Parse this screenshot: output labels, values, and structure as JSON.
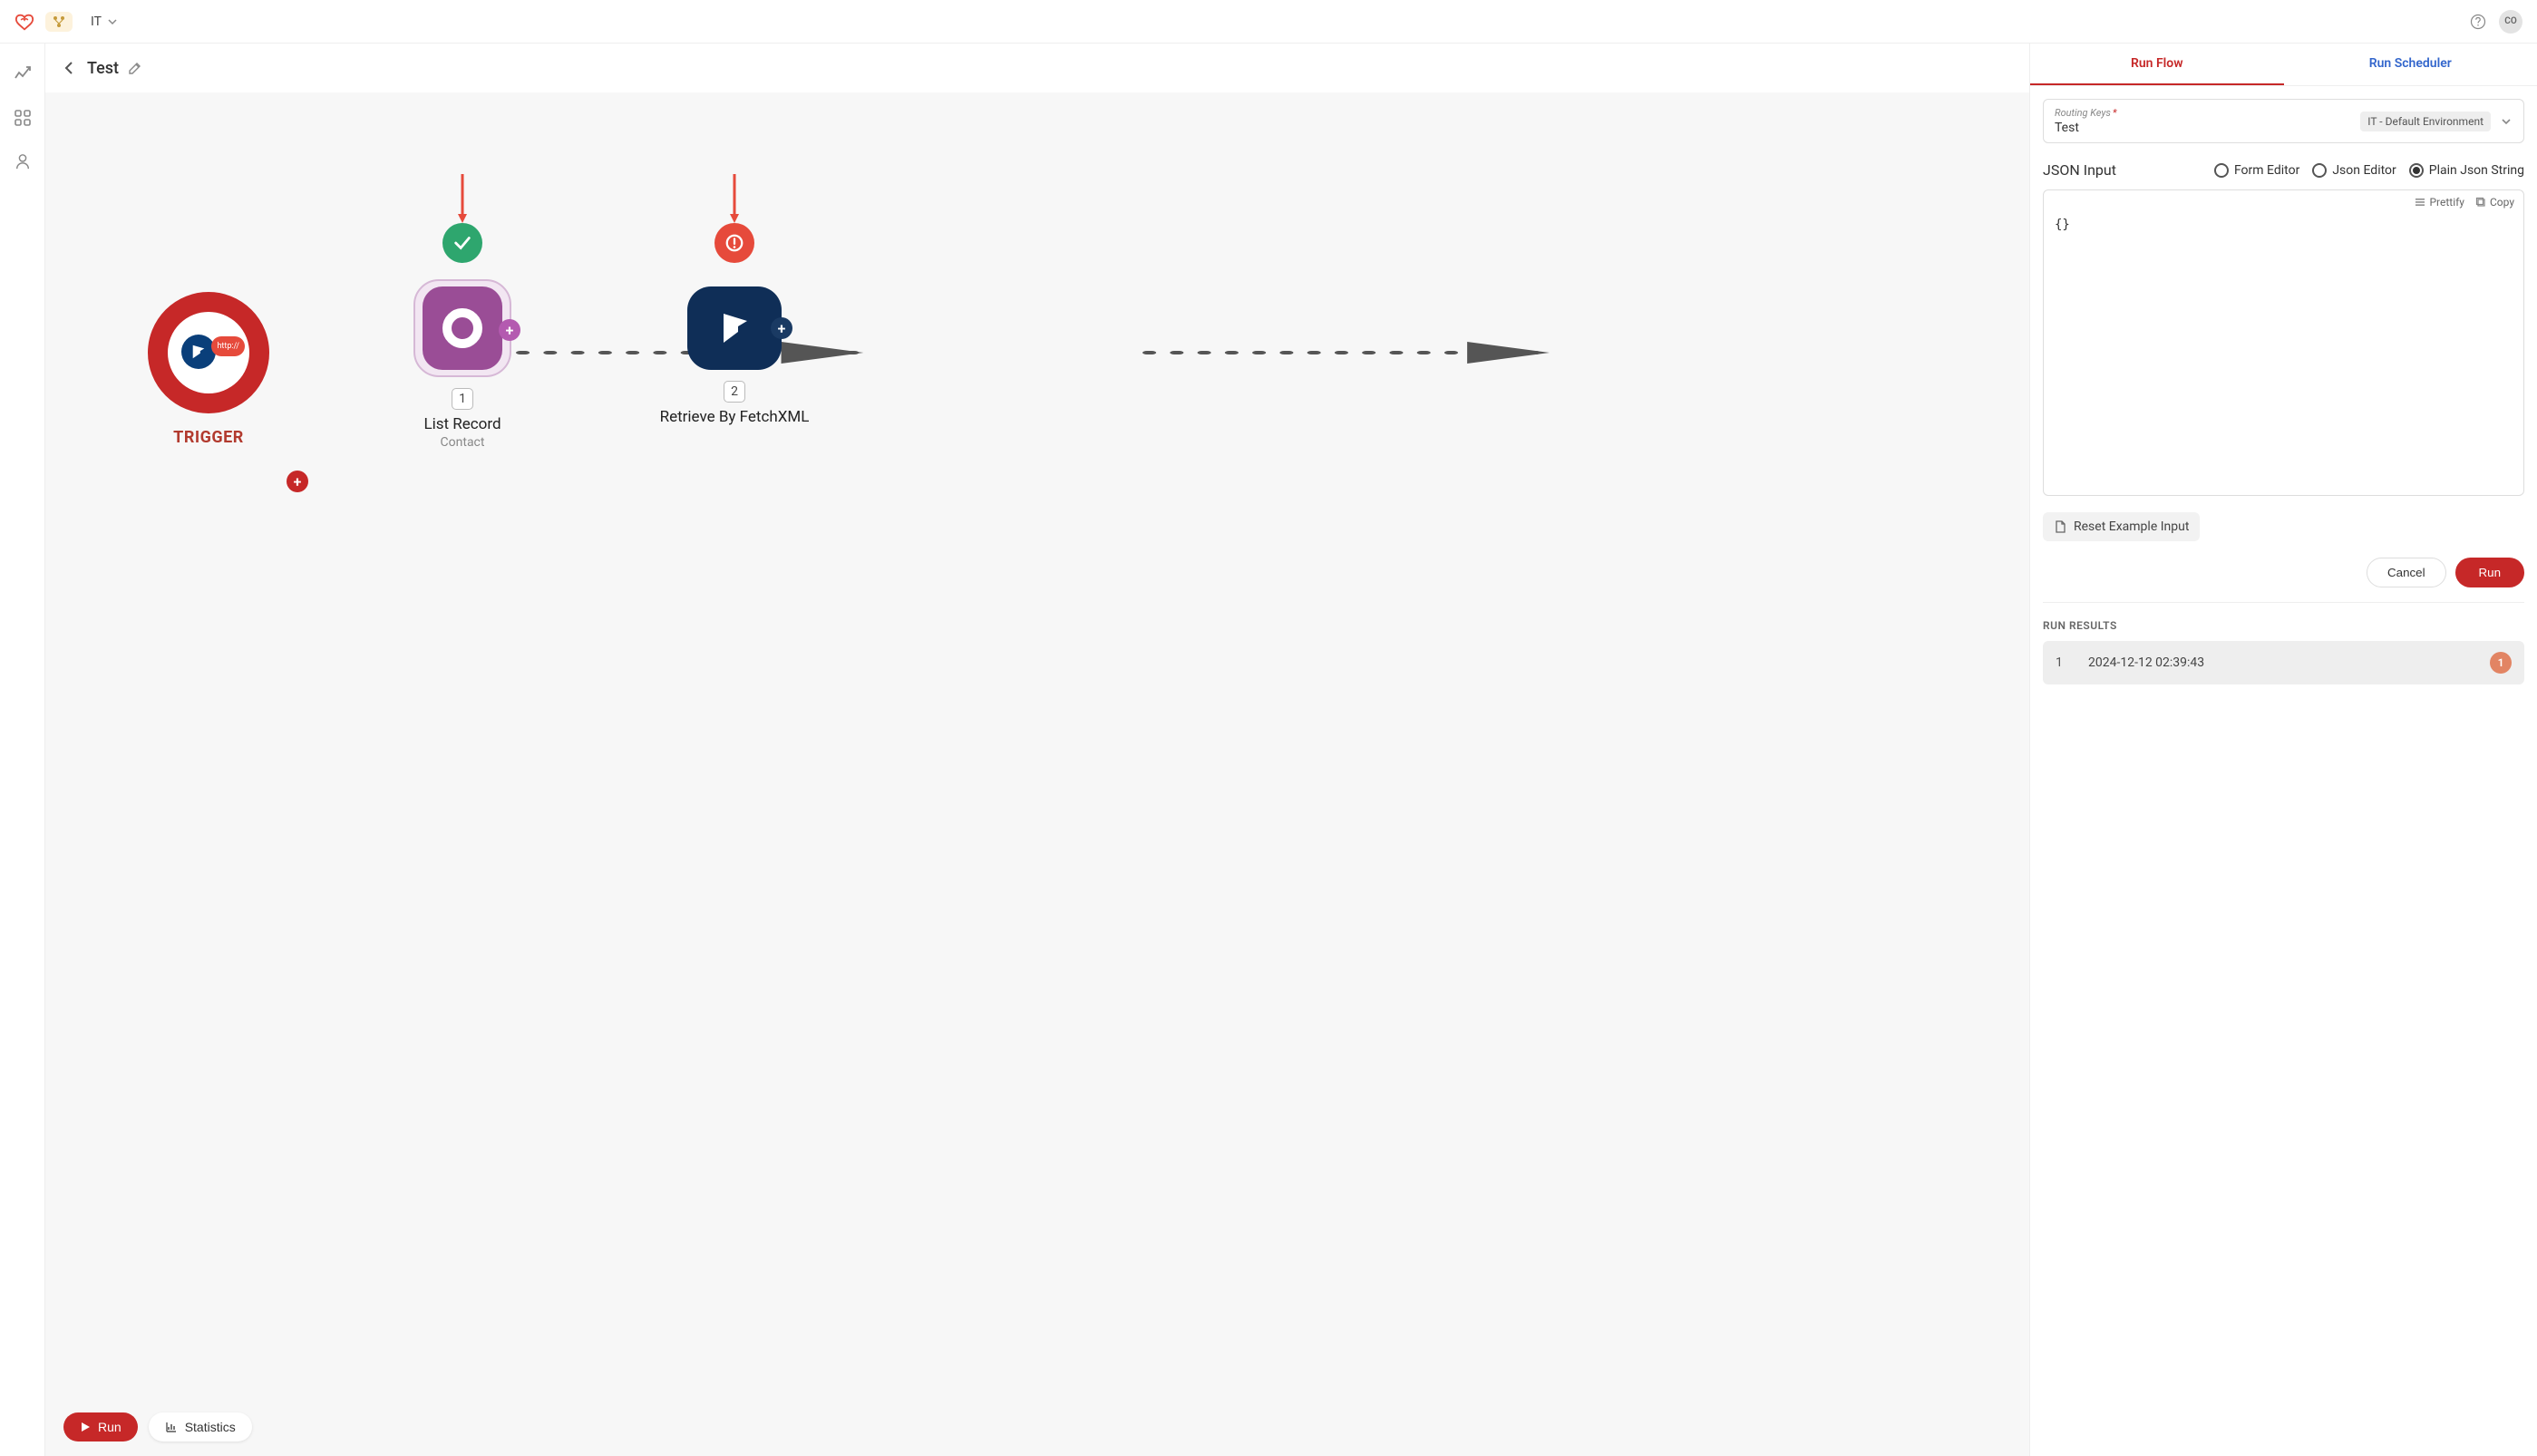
{
  "topbar": {
    "project_code": "IT",
    "avatar_initials": "CO"
  },
  "canvas": {
    "title": "Test",
    "trigger": {
      "label": "TRIGGER",
      "http_chip": "http://"
    },
    "node1": {
      "number": "1",
      "title": "List Record",
      "subtitle": "Contact"
    },
    "node2": {
      "number": "2",
      "title": "Retrieve By FetchXML"
    },
    "footer": {
      "run": "Run",
      "stats": "Statistics"
    }
  },
  "right": {
    "tabs": {
      "run_flow": "Run Flow",
      "run_scheduler": "Run Scheduler"
    },
    "routing": {
      "label": "Routing Keys",
      "value": "Test",
      "env_tag": "IT - Default Environment"
    },
    "json_label": "JSON Input",
    "editors": {
      "form": "Form Editor",
      "json": "Json Editor",
      "plain": "Plain Json String"
    },
    "json_toolbar": {
      "prettify": "Prettify",
      "copy": "Copy"
    },
    "json_value": "{}",
    "reset_label": "Reset Example Input",
    "actions": {
      "cancel": "Cancel",
      "run": "Run"
    },
    "results_label": "RUN RESULTS",
    "results": [
      {
        "index": "1",
        "timestamp": "2024-12-12 02:39:43",
        "badge": "1"
      }
    ]
  }
}
